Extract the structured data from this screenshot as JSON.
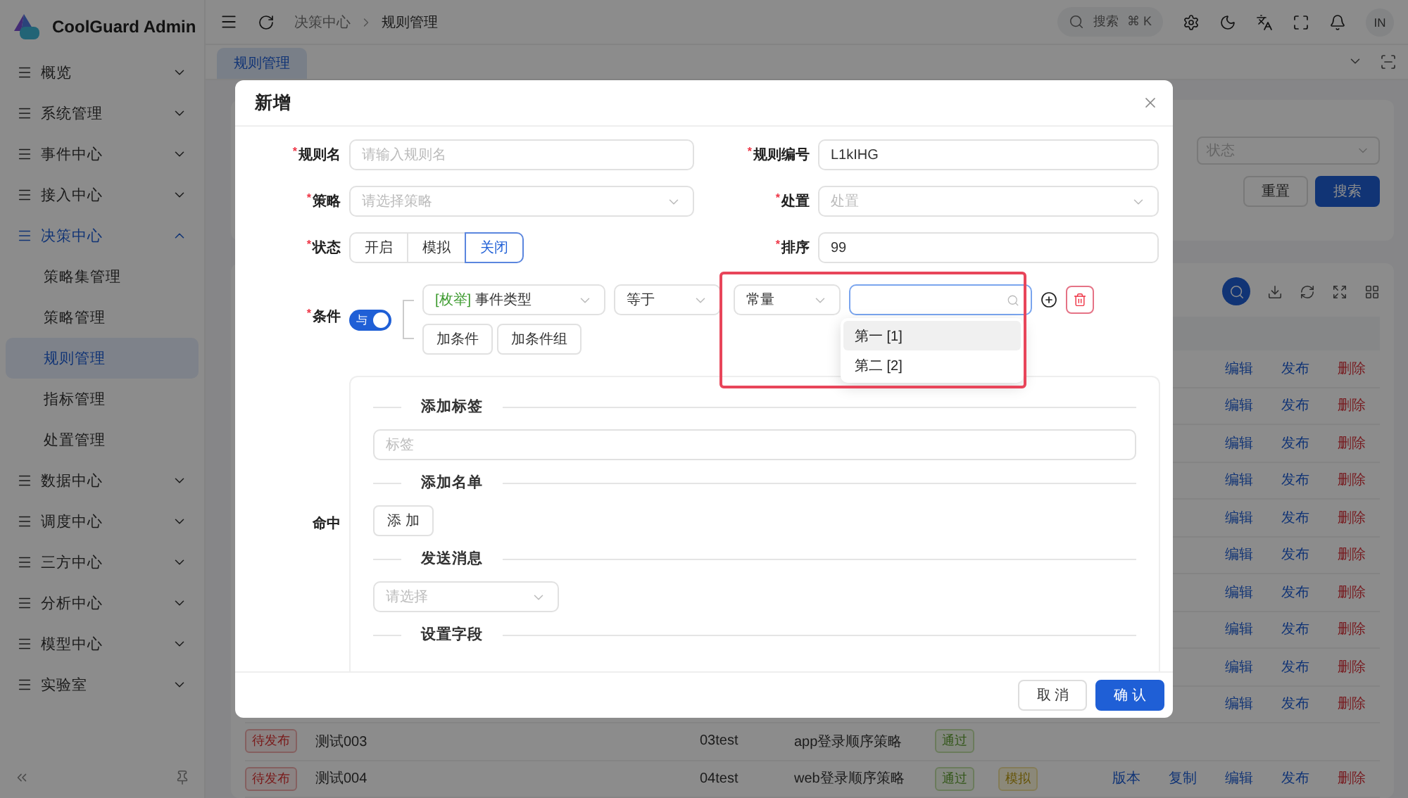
{
  "app": {
    "title": "CoolGuard Admin"
  },
  "sidebar": {
    "items": [
      {
        "label": "概览",
        "expanded": false
      },
      {
        "label": "系统管理",
        "expanded": false
      },
      {
        "label": "事件中心",
        "expanded": false
      },
      {
        "label": "接入中心",
        "expanded": false
      },
      {
        "label": "决策中心",
        "expanded": true,
        "children": [
          {
            "label": "策略集管理",
            "selected": false
          },
          {
            "label": "策略管理",
            "selected": false
          },
          {
            "label": "规则管理",
            "selected": true
          },
          {
            "label": "指标管理",
            "selected": false
          },
          {
            "label": "处置管理",
            "selected": false
          }
        ]
      },
      {
        "label": "数据中心",
        "expanded": false
      },
      {
        "label": "调度中心",
        "expanded": false
      },
      {
        "label": "三方中心",
        "expanded": false
      },
      {
        "label": "分析中心",
        "expanded": false
      },
      {
        "label": "模型中心",
        "expanded": false
      },
      {
        "label": "实验室",
        "expanded": false
      }
    ]
  },
  "header": {
    "breadcrumb": [
      "决策中心",
      "规则管理"
    ],
    "search": {
      "placeholder": "搜索",
      "shortcut": "⌘ K"
    },
    "avatar": "IN"
  },
  "tabs": [
    {
      "label": "规则管理",
      "selected": true
    }
  ],
  "filter": {
    "status_select": {
      "placeholder": "状态"
    },
    "buttons": [
      {
        "label": "重置",
        "kind": "default"
      },
      {
        "label": "搜索",
        "kind": "primary"
      }
    ]
  },
  "table": {
    "rows": [
      {
        "ops": [
          {
            "label": "编辑",
            "kind": "link"
          },
          {
            "label": "发布",
            "kind": "link"
          },
          {
            "label": "删除",
            "kind": "danger"
          }
        ]
      },
      {
        "ops": [
          {
            "label": "编辑",
            "kind": "link"
          },
          {
            "label": "发布",
            "kind": "link"
          },
          {
            "label": "删除",
            "kind": "danger"
          }
        ]
      },
      {
        "ops": [
          {
            "label": "编辑",
            "kind": "link"
          },
          {
            "label": "发布",
            "kind": "link"
          },
          {
            "label": "删除",
            "kind": "danger"
          }
        ]
      },
      {
        "ops": [
          {
            "label": "编辑",
            "kind": "link"
          },
          {
            "label": "发布",
            "kind": "link"
          },
          {
            "label": "删除",
            "kind": "danger"
          }
        ]
      },
      {
        "ops": [
          {
            "label": "编辑",
            "kind": "link"
          },
          {
            "label": "发布",
            "kind": "link"
          },
          {
            "label": "删除",
            "kind": "danger"
          }
        ]
      },
      {
        "ops": [
          {
            "label": "编辑",
            "kind": "link"
          },
          {
            "label": "发布",
            "kind": "link"
          },
          {
            "label": "删除",
            "kind": "danger"
          }
        ]
      },
      {
        "ops": [
          {
            "label": "编辑",
            "kind": "link"
          },
          {
            "label": "发布",
            "kind": "link"
          },
          {
            "label": "删除",
            "kind": "danger"
          }
        ]
      },
      {
        "ops": [
          {
            "label": "编辑",
            "kind": "link"
          },
          {
            "label": "发布",
            "kind": "link"
          },
          {
            "label": "删除",
            "kind": "danger"
          }
        ]
      },
      {
        "ops": [
          {
            "label": "编辑",
            "kind": "link"
          },
          {
            "label": "发布",
            "kind": "link"
          },
          {
            "label": "删除",
            "kind": "danger"
          }
        ]
      },
      {
        "ops": [
          {
            "label": "编辑",
            "kind": "link"
          },
          {
            "label": "发布",
            "kind": "link"
          },
          {
            "label": "删除",
            "kind": "danger"
          }
        ]
      },
      {
        "status": "待发布",
        "name": "测试003",
        "code": "03test",
        "strategy": "app登录顺序策略",
        "verdict": "通过",
        "ops": []
      },
      {
        "status": "待发布",
        "name": "测试004",
        "code": "04test",
        "strategy": "web登录顺序策略",
        "verdict": "通过",
        "mode": "模拟",
        "ops": [
          {
            "label": "版本",
            "kind": "link"
          },
          {
            "label": "复制",
            "kind": "link"
          },
          {
            "label": "编辑",
            "kind": "link"
          },
          {
            "label": "发布",
            "kind": "link"
          },
          {
            "label": "删除",
            "kind": "danger"
          }
        ]
      }
    ]
  },
  "modal": {
    "title": "新增",
    "required_mark": "*",
    "fields": [
      {
        "label": "规则名",
        "kind": "input",
        "placeholder": "请输入规则名",
        "required": true
      },
      {
        "label": "规则编号",
        "kind": "input",
        "value": "L1kIHG",
        "required": true
      },
      {
        "label": "策略",
        "kind": "select",
        "placeholder": "请选择策略",
        "required": true
      },
      {
        "label": "处置",
        "kind": "select",
        "placeholder": "处置",
        "required": true
      },
      {
        "label": "状态",
        "kind": "segmented",
        "required": true,
        "options": [
          {
            "label": "开启",
            "selected": false
          },
          {
            "label": "模拟",
            "selected": false
          },
          {
            "label": "关闭",
            "selected": true
          }
        ]
      },
      {
        "label": "排序",
        "kind": "input",
        "value": "99",
        "required": true
      }
    ],
    "condition": {
      "label": "条件",
      "required": true,
      "logic": {
        "label": "与",
        "on": true
      },
      "row": {
        "field_tag": "[枚举]",
        "field": "事件类型",
        "operator": "等于",
        "value_type": "常量",
        "value_input": {
          "focused": true
        }
      },
      "buttons": [
        "加条件",
        "加条件组"
      ],
      "dropdown": [
        {
          "label": "第一 [1]",
          "selected": true
        },
        {
          "label": "第二 [2]",
          "selected": false
        }
      ]
    },
    "hit": {
      "label": "命中",
      "sections": [
        {
          "title": "添加标签",
          "kind": "input",
          "placeholder": "标签"
        },
        {
          "title": "添加名单",
          "kind": "button",
          "button": "添 加"
        },
        {
          "title": "发送消息",
          "kind": "select",
          "placeholder": "请选择"
        },
        {
          "title": "设置字段",
          "kind": "none"
        }
      ]
    },
    "footer": [
      {
        "label": "取 消",
        "kind": "default"
      },
      {
        "label": "确 认",
        "kind": "primary"
      }
    ]
  }
}
